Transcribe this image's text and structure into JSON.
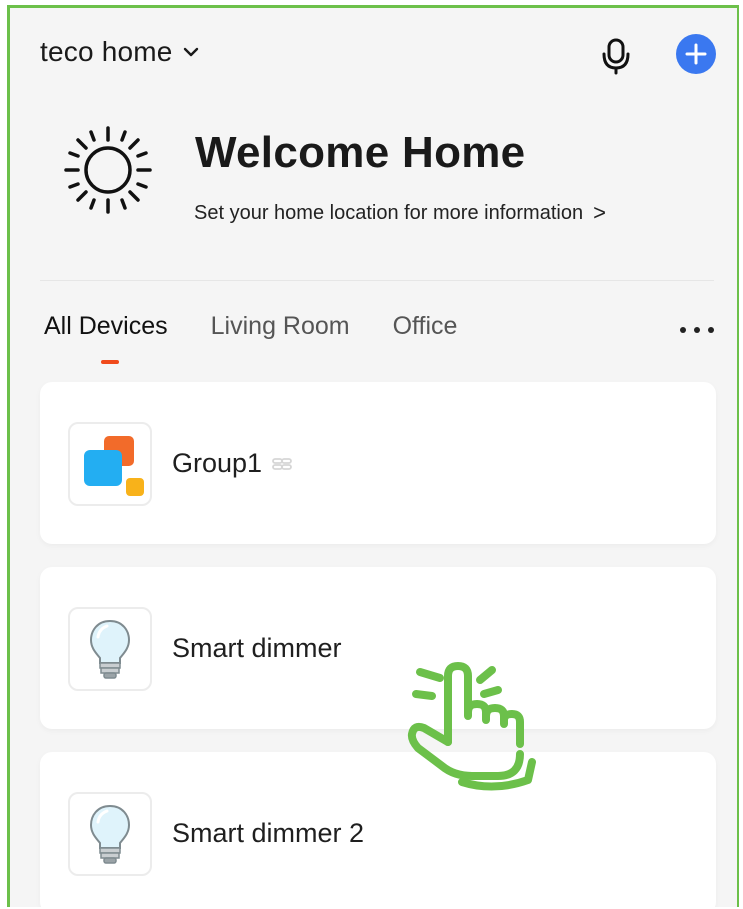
{
  "header": {
    "home_name": "teco home",
    "icons": {
      "dropdown": "chevron-down-icon",
      "voice": "microphone-icon",
      "add": "plus-icon"
    },
    "accent_color": "#3a78f0"
  },
  "welcome": {
    "icon": "sun-icon",
    "title": "Welcome Home",
    "location_prompt": "Set your home location for more information",
    "location_chevron": ">"
  },
  "tabs": {
    "items": [
      {
        "label": "All Devices",
        "active": true
      },
      {
        "label": "Living Room",
        "active": false
      },
      {
        "label": "Office",
        "active": false
      }
    ],
    "indicator_color": "#f04a1c",
    "more_icon": "more-horizontal-icon"
  },
  "devices": [
    {
      "name": "Group1",
      "icon": "group-icon",
      "linked": true
    },
    {
      "name": "Smart dimmer",
      "icon": "bulb-icon",
      "linked": false
    },
    {
      "name": "Smart dimmer 2",
      "icon": "bulb-icon",
      "linked": false
    }
  ],
  "overlay": {
    "icon": "tap-hand-icon",
    "color": "#6cc04a"
  }
}
